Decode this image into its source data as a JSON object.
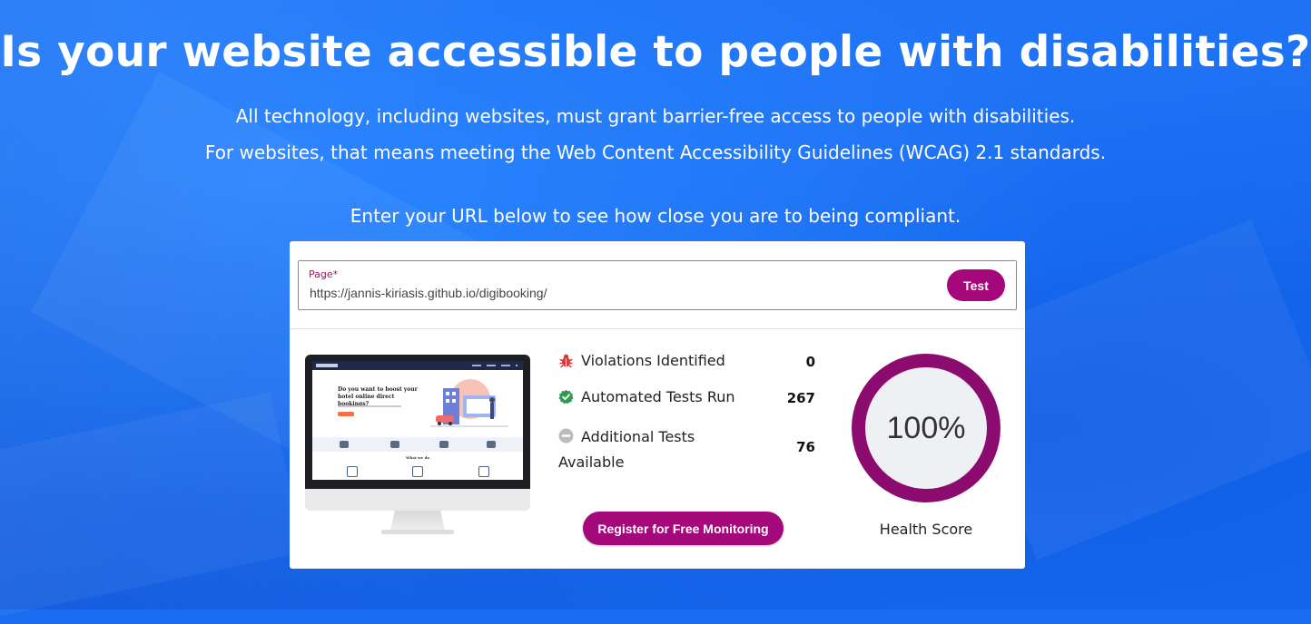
{
  "hero": {
    "title": "Is your website accessible to people with disabilities?",
    "line1": "All technology, including websites, must grant barrier-free access to people with disabilities.",
    "line2": "For websites, that means meeting the Web Content Accessibility Guidelines (WCAG) 2.1 standards.",
    "line3": "Enter your URL below to see how close you are to being compliant."
  },
  "form": {
    "label": "Page",
    "required_marker": "*",
    "url_value": "https://jannis-kiriasis.github.io/digibooking/",
    "test_button": "Test"
  },
  "preview": {
    "hero_title": "Do you want to boost your hotel online direct bookings?",
    "section_title": "What we do"
  },
  "stats": {
    "violations": {
      "label": "Violations Identified",
      "value": "0",
      "icon": "bug-icon",
      "color": "#e0333a"
    },
    "automated": {
      "label": "Automated Tests Run",
      "value": "267",
      "icon": "check-badge-icon",
      "color": "#2e9a4c"
    },
    "additional": {
      "label": "Additional Tests Available",
      "value": "76",
      "icon": "minus-circle-icon",
      "color": "#b8bcc2"
    }
  },
  "register_button": "Register for Free Monitoring",
  "health": {
    "value": "100%",
    "label": "Health Score",
    "score_fraction": 1.0,
    "ring_color": "#8c0b6f"
  },
  "colors": {
    "background": "#1a6df0",
    "accent": "#a4087a"
  }
}
